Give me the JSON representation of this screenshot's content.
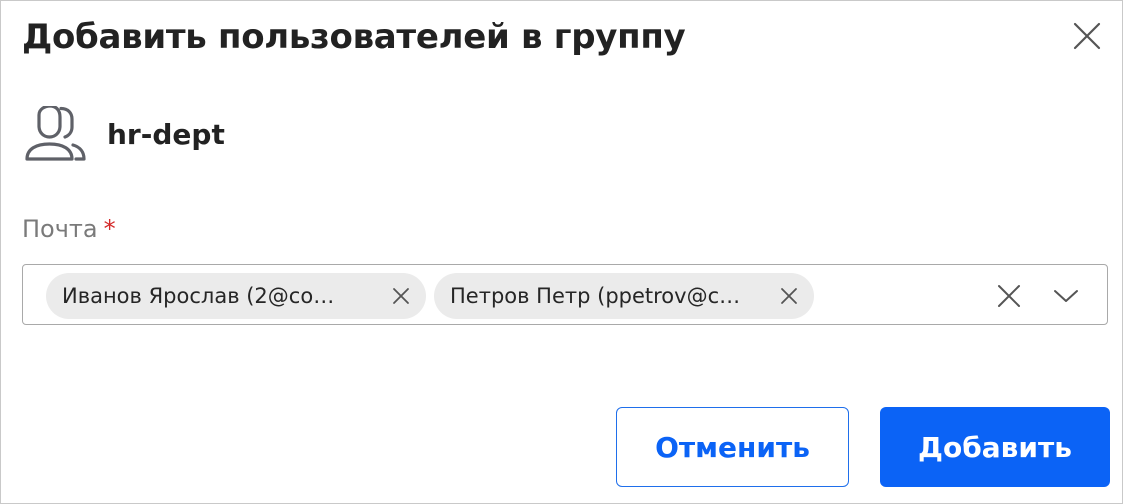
{
  "dialog": {
    "title": "Добавить пользователей в группу",
    "close_icon": "close-icon"
  },
  "group": {
    "icon": "users-icon",
    "name": "hr-dept"
  },
  "email_field": {
    "label": "Почта",
    "required_mark": "*",
    "selected": [
      {
        "label": "Иванов Ярослав (2@co…"
      },
      {
        "label": "Петров Петр (ppetrov@c…"
      }
    ],
    "clear_icon": "clear-icon",
    "dropdown_icon": "chevron-down-icon"
  },
  "actions": {
    "cancel_label": "Отменить",
    "add_label": "Добавить"
  },
  "colors": {
    "primary": "#0b63f6",
    "chip_bg": "#ebebeb",
    "required": "#d42a2a",
    "label": "#7a7a7a"
  }
}
